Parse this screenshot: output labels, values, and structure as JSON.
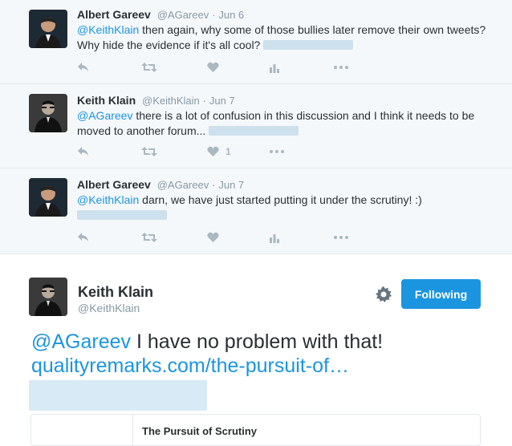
{
  "tweets": [
    {
      "name": "Albert Gareev",
      "handle": "@AGareev",
      "sep": "·",
      "date": "Jun 6",
      "mention": "@KeithKlain",
      "text": " then again, why some of those bullies later remove their own tweets? Why hide the evidence if it's all cool?",
      "like_count": ""
    },
    {
      "name": "Keith Klain",
      "handle": "@KeithKlain",
      "sep": "·",
      "date": "Jun 7",
      "mention": "@AGareev",
      "text": " there is a lot of confusion in this discussion and I think it needs to be moved to another forum...",
      "like_count": "1"
    },
    {
      "name": "Albert Gareev",
      "handle": "@AGareev",
      "sep": "·",
      "date": "Jun 7",
      "mention": "@KeithKlain",
      "text": " darn, we have just started putting it under the scrutiny! :)",
      "like_count": ""
    }
  ],
  "icons": {
    "reply": "reply-icon",
    "retweet": "retweet-icon",
    "like": "heart-icon",
    "stats": "analytics-icon",
    "more": "more-icon"
  },
  "main_tweet": {
    "name": "Keith Klain",
    "handle": "@KeithKlain",
    "follow_label": "Following",
    "mention": "@AGareev",
    "text": " I have no problem with that!",
    "link": "qualityremarks.com/the-pursuit-of…",
    "card_title": "The Pursuit of Scrutiny"
  },
  "colors": {
    "accent": "#1b95e0",
    "thread_bg": "#f5f8fa",
    "muted": "#8899a6",
    "icon": "#aab8c2"
  }
}
